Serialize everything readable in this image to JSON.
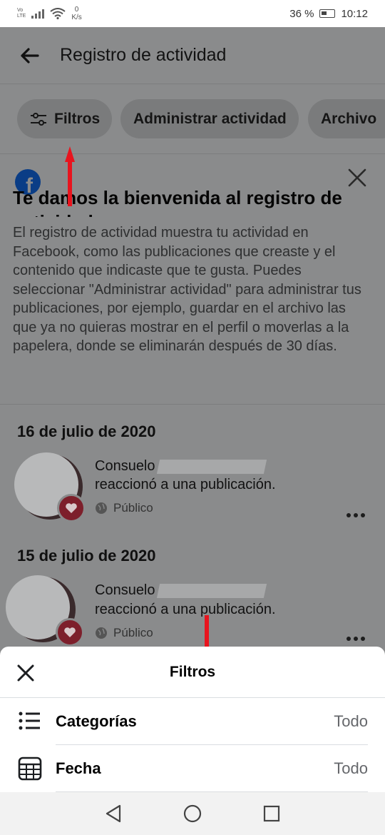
{
  "status_bar": {
    "network_top": "Vo",
    "network_bottom": "LTE",
    "speed_value": "0",
    "speed_unit": "K/s",
    "battery": "36 %",
    "time": "10:12"
  },
  "header": {
    "title": "Registro de actividad"
  },
  "chips": [
    {
      "label": "Filtros",
      "icon": "sliders-icon"
    },
    {
      "label": "Administrar actividad"
    },
    {
      "label": "Archivo"
    }
  ],
  "welcome": {
    "logo": "f",
    "title": "Te damos la bienvenida al registro de actividad",
    "body": "El registro de actividad muestra tu actividad en Facebook, como las publicaciones que creaste y el contenido que indicaste que te gusta. Puedes seleccionar \"Administrar actividad\" para administrar tus publicaciones, por ejemplo, guardar en el archivo las que ya no quieras mostrar en el perfil o moverlas a la papelera, donde se eliminarán después de 30 días."
  },
  "feed": {
    "groups": [
      {
        "date": "16 de julio de 2020",
        "item": {
          "name": "Consuelo",
          "action": "reaccionó a una publicación.",
          "privacy": "Público"
        }
      },
      {
        "date": "15 de julio de 2020",
        "item": {
          "name": "Consuelo",
          "action": "reaccionó a una publicación.",
          "privacy": "Público"
        }
      }
    ]
  },
  "sheet": {
    "title": "Filtros",
    "rows": [
      {
        "label": "Categorías",
        "value": "Todo",
        "icon": "list-icon"
      },
      {
        "label": "Fecha",
        "value": "Todo",
        "icon": "calendar-icon"
      }
    ]
  },
  "colors": {
    "overlay": "#8a8b8c",
    "annotation_arrow": "#e8141e",
    "reaction_badge": "#7d1f2b"
  }
}
